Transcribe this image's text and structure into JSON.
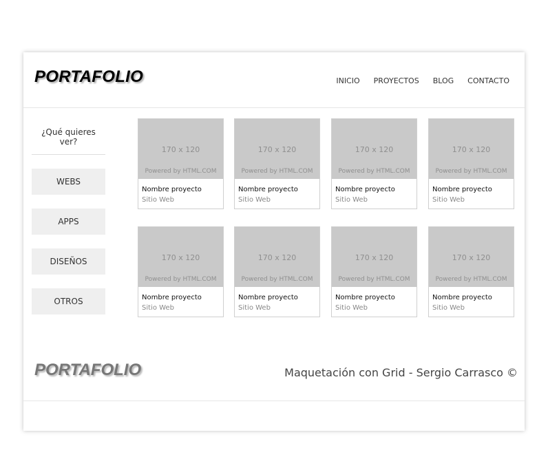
{
  "header": {
    "logo": "PORTAFOLIO",
    "nav": [
      "INICIO",
      "PROYECTOS",
      "BLOG",
      "CONTACTO"
    ]
  },
  "sidebar": {
    "title": "¿Qué quieres ver?",
    "buttons": [
      "WEBS",
      "APPS",
      "DISEÑOS",
      "OTROS"
    ]
  },
  "projects": [
    {
      "placeholder": "170 x 120",
      "powered": "Powered by HTML.COM",
      "name": "Nombre proyecto",
      "category": "Sitio Web"
    },
    {
      "placeholder": "170 x 120",
      "powered": "Powered by HTML.COM",
      "name": "Nombre proyecto",
      "category": "Sitio Web"
    },
    {
      "placeholder": "170 x 120",
      "powered": "Powered by HTML.COM",
      "name": "Nombre proyecto",
      "category": "Sitio Web"
    },
    {
      "placeholder": "170 x 120",
      "powered": "Powered by HTML.COM",
      "name": "Nombre proyecto",
      "category": "Sitio Web"
    },
    {
      "placeholder": "170 x 120",
      "powered": "Powered by HTML.COM",
      "name": "Nombre proyecto",
      "category": "Sitio Web"
    },
    {
      "placeholder": "170 x 120",
      "powered": "Powered by HTML.COM",
      "name": "Nombre proyecto",
      "category": "Sitio Web"
    },
    {
      "placeholder": "170 x 120",
      "powered": "Powered by HTML.COM",
      "name": "Nombre proyecto",
      "category": "Sitio Web"
    },
    {
      "placeholder": "170 x 120",
      "powered": "Powered by HTML.COM",
      "name": "Nombre proyecto",
      "category": "Sitio Web"
    }
  ],
  "footer": {
    "logo": "PORTAFOLIO",
    "credit": "Maquetación con Grid - Sergio Carrasco ©"
  },
  "colors": {
    "placeholder_bg": "#c9c9c9",
    "sidebar_button_bg": "#efefef",
    "footer_logo": "#777777"
  }
}
